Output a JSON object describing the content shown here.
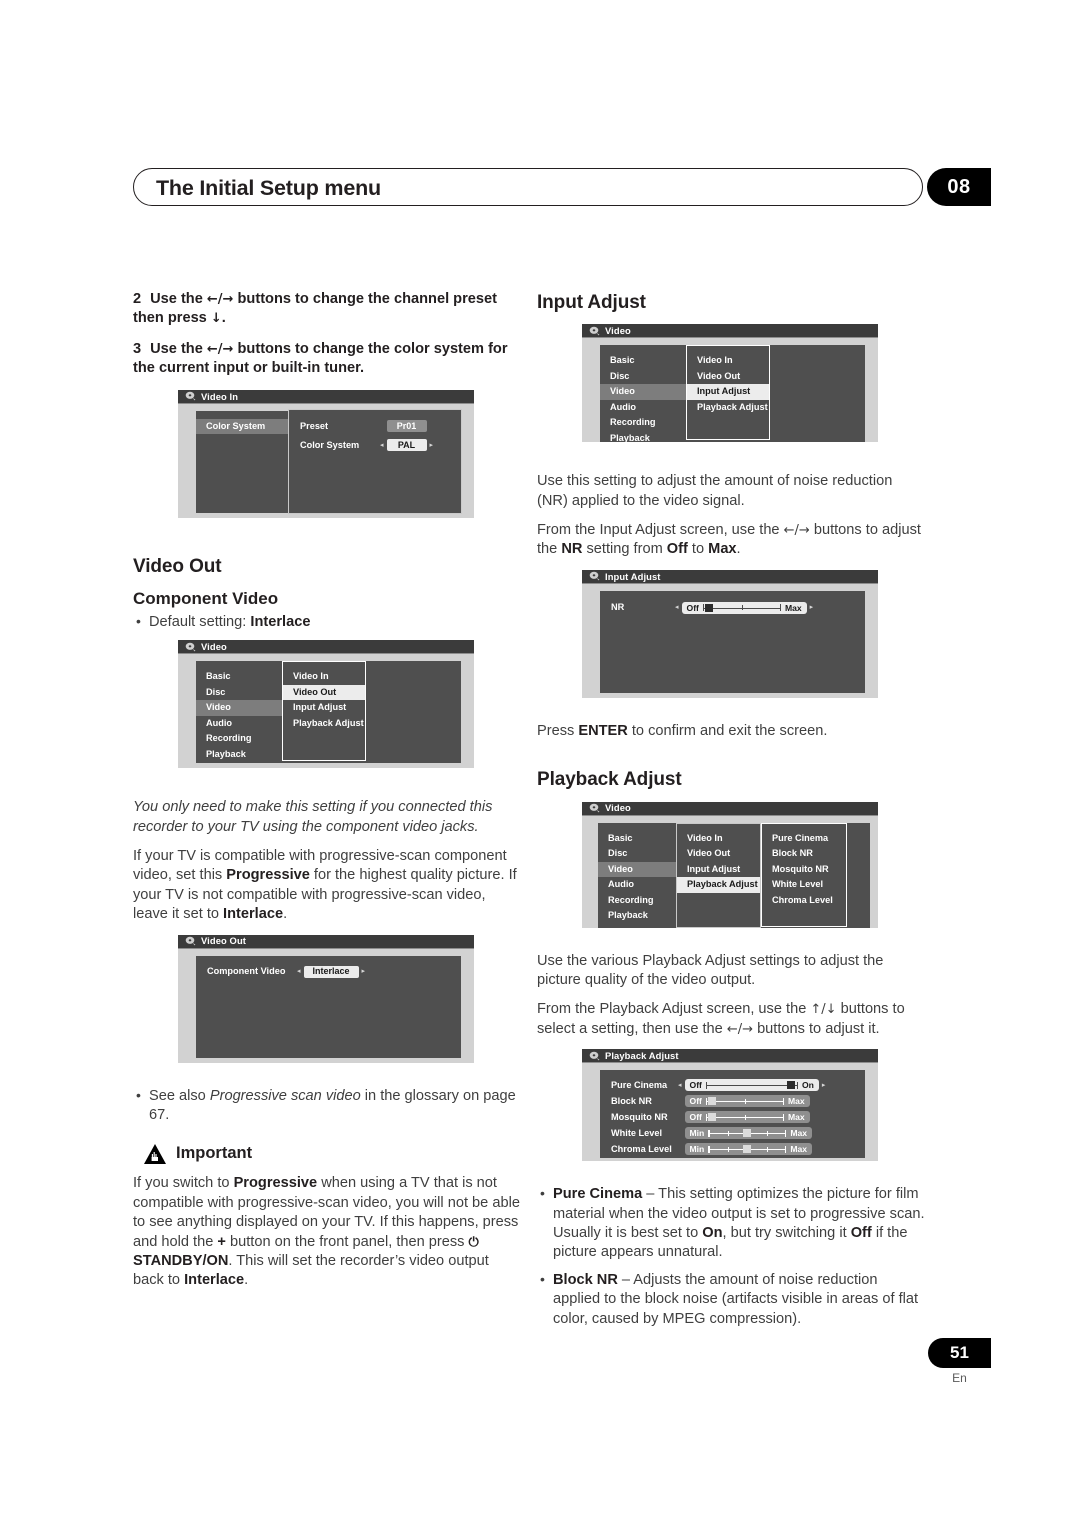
{
  "header": {
    "title": "The Initial Setup menu",
    "chapter": "08"
  },
  "footer": {
    "page_number": "51",
    "language": "En"
  },
  "left_column": {
    "step2": {
      "num": "2",
      "text_a": "Use the ",
      "arrows": "←/→",
      "text_b": " buttons to change the channel preset then press ",
      "arrow_down": "↓",
      "text_c": "."
    },
    "step3": {
      "num": "3",
      "text_a": "Use the ",
      "arrows": "←/→",
      "text_b": " buttons to change the color system for the current input or built-in tuner."
    },
    "osd_video_in": {
      "titlebar": "Video In",
      "menu_label": "Color System",
      "rows": [
        {
          "label": "Preset",
          "value": "Pr01",
          "style": "grey",
          "arrows": false
        },
        {
          "label": "Color System",
          "value": "PAL",
          "style": "white",
          "arrows": true
        }
      ]
    },
    "heading_video_out": "Video Out",
    "heading_component_video": "Component Video",
    "default_setting_prefix": "Default setting: ",
    "default_setting_value": "Interlace",
    "osd_video_menu": {
      "titlebar": "Video",
      "col1": [
        "Basic",
        "Disc",
        "Video",
        "Audio",
        "Recording",
        "Playback"
      ],
      "col1_selected": "Video",
      "col2": [
        "Video In",
        "Video Out",
        "Input Adjust",
        "Playback Adjust"
      ],
      "col2_selected": "Video Out"
    },
    "italic_note": "You only need to make this setting if you connected this recorder to your TV using the component video jacks.",
    "para_progressive": {
      "a": "If your TV is compatible with progressive-scan component video, set this ",
      "b1": "Progressive",
      "c": " for the highest quality picture. If your TV is not compatible with progressive-scan video, leave it set to ",
      "b2": "Interlace",
      "d": "."
    },
    "osd_video_out": {
      "titlebar": "Video Out",
      "rows": [
        {
          "label": "Component Video",
          "value": "Interlace",
          "style": "white",
          "arrows": true
        }
      ]
    },
    "bullet_glossary": {
      "a": "See also ",
      "italic": "Progressive scan video",
      "b": " in the glossary on page 67."
    },
    "important_label": "Important",
    "para_important": {
      "a": "If you switch to ",
      "b1": "Progressive",
      "c": " when using a TV that is not compatible with progressive-scan video, you will not be able to see anything displayed on your TV. If this happens, press and hold the ",
      "plus": "+",
      "d": " button on the front panel, then press ",
      "power": "⏻",
      "b2": "STANDBY/ON",
      "e": ". This will set the recorder’s video output back to ",
      "b3": "Interlace",
      "f": "."
    }
  },
  "right_column": {
    "heading_input_adjust": "Input Adjust",
    "osd_video_menu_input": {
      "titlebar": "Video",
      "col1": [
        "Basic",
        "Disc",
        "Video",
        "Audio",
        "Recording",
        "Playback"
      ],
      "col1_selected": "Video",
      "col2": [
        "Video In",
        "Video Out",
        "Input Adjust",
        "Playback Adjust"
      ],
      "col2_selected": "Input Adjust"
    },
    "para_nr_1": "Use this setting to adjust the amount of noise reduction (NR) applied to the video signal.",
    "para_nr_2": {
      "a": "From the Input Adjust screen, use the ",
      "arrows": "←/→",
      "b": " buttons to adjust the ",
      "b1": "NR",
      "c": " setting from ",
      "b2": "Off",
      "d": " to ",
      "b3": "Max",
      "e": "."
    },
    "osd_input_adjust": {
      "titlebar": "Input Adjust",
      "rows": [
        {
          "label": "NR",
          "min_label": "Off",
          "max_label": "Max",
          "knob_percent": 8,
          "style": "light",
          "arrows": true
        }
      ]
    },
    "para_enter": {
      "a": "Press ",
      "b": "ENTER",
      "c": " to confirm and exit the screen."
    },
    "heading_playback_adjust": "Playback Adjust",
    "osd_video_menu_playback": {
      "titlebar": "Video",
      "col1": [
        "Basic",
        "Disc",
        "Video",
        "Audio",
        "Recording",
        "Playback"
      ],
      "col1_selected": "Video",
      "col2": [
        "Video In",
        "Video Out",
        "Input Adjust",
        "Playback Adjust"
      ],
      "col2_selected": "Playback Adjust",
      "col3": [
        "Pure Cinema",
        "Block NR",
        "Mosquito NR",
        "White Level",
        "Chroma Level"
      ]
    },
    "para_pb_1": "Use the various Playback Adjust settings to adjust the picture quality of the video output.",
    "para_pb_2": {
      "a": "From the Playback Adjust screen, use the ",
      "arrows_ud": "↑/↓",
      "b": " buttons to select a setting, then use the ",
      "arrows_lr": "←/→",
      "c": " buttons to adjust it."
    },
    "osd_playback_adjust": {
      "titlebar": "Playback Adjust",
      "rows": [
        {
          "label": "Pure Cinema",
          "min_label": "Off",
          "max_label": "On",
          "knob_percent": 92,
          "style": "light",
          "arrows": true
        },
        {
          "label": "Block NR",
          "min_label": "Off",
          "max_label": "Max",
          "knob_percent": 8,
          "style": "grey",
          "arrows": false
        },
        {
          "label": "Mosquito NR",
          "min_label": "Off",
          "max_label": "Max",
          "knob_percent": 8,
          "style": "grey",
          "arrows": false
        },
        {
          "label": "White Level",
          "min_label": "Min",
          "max_label": "Max",
          "knob_percent": 50,
          "style": "grey",
          "arrows": false
        },
        {
          "label": "Chroma Level",
          "min_label": "Min",
          "max_label": "Max",
          "knob_percent": 50,
          "style": "grey",
          "arrows": false
        }
      ]
    },
    "bullet_pure_cinema": {
      "b1": "Pure Cinema",
      "a": " – This setting optimizes the picture for film material when the video output is set to progressive scan. Usually it is best set to ",
      "b2": "On",
      "b": ", but try switching it ",
      "b3": "Off",
      "c": " if the picture appears unnatural."
    },
    "bullet_block_nr": {
      "b1": "Block NR",
      "a": " – Adjusts the amount of noise reduction applied to the block noise (artifacts visible in areas of flat color, caused by MPEG compression)."
    }
  }
}
